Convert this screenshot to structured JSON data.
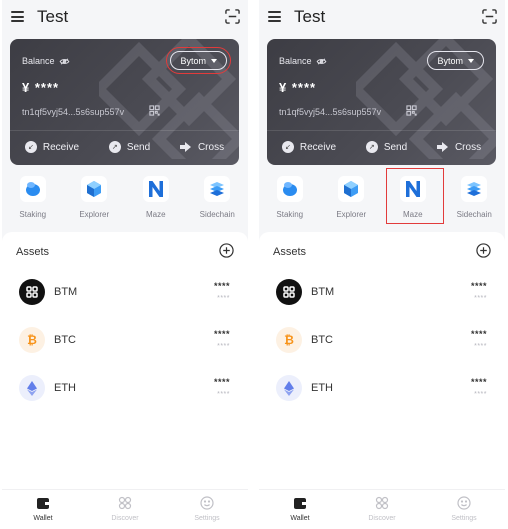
{
  "screens": [
    {
      "app_title": "Test",
      "balance": {
        "label": "Balance",
        "chain": "Bytom",
        "value": "¥ ****",
        "address": "tn1qf5vyj54...5s6sup557v",
        "chain_highlighted": true
      },
      "actions": {
        "receive": "Receive",
        "send": "Send",
        "cross": "Cross"
      },
      "dapps": [
        {
          "label": "Staking",
          "icon": "staking-icon"
        },
        {
          "label": "Explorer",
          "icon": "explorer-cube-icon"
        },
        {
          "label": "Maze",
          "icon": "maze-n-icon"
        },
        {
          "label": "Sidechain",
          "icon": "sidechain-layers-icon"
        }
      ],
      "maze_highlighted": false,
      "assets_title": "Assets",
      "assets": [
        {
          "name": "BTM",
          "amount": "****",
          "value": "****",
          "logo_color": "#111111"
        },
        {
          "name": "BTC",
          "amount": "****",
          "value": "****",
          "logo_color": "#f7931a"
        },
        {
          "name": "ETH",
          "amount": "****",
          "value": "****",
          "logo_color": "#627eea"
        }
      ],
      "tabs": [
        {
          "label": "Wallet",
          "active": true
        },
        {
          "label": "Discover",
          "active": false
        },
        {
          "label": "Settings",
          "active": false
        }
      ]
    },
    {
      "app_title": "Test",
      "balance": {
        "label": "Balance",
        "chain": "Bytom",
        "value": "¥ ****",
        "address": "tn1qf5vyj54...5s6sup557v",
        "chain_highlighted": false
      },
      "actions": {
        "receive": "Receive",
        "send": "Send",
        "cross": "Cross"
      },
      "dapps": [
        {
          "label": "Staking",
          "icon": "staking-icon"
        },
        {
          "label": "Explorer",
          "icon": "explorer-cube-icon"
        },
        {
          "label": "Maze",
          "icon": "maze-n-icon"
        },
        {
          "label": "Sidechain",
          "icon": "sidechain-layers-icon"
        }
      ],
      "maze_highlighted": true,
      "assets_title": "Assets",
      "assets": [
        {
          "name": "BTM",
          "amount": "****",
          "value": "****",
          "logo_color": "#111111"
        },
        {
          "name": "BTC",
          "amount": "****",
          "value": "****",
          "logo_color": "#f7931a"
        },
        {
          "name": "ETH",
          "amount": "****",
          "value": "****",
          "logo_color": "#627eea"
        }
      ],
      "tabs": [
        {
          "label": "Wallet",
          "active": true
        },
        {
          "label": "Discover",
          "active": false
        },
        {
          "label": "Settings",
          "active": false
        }
      ]
    }
  ],
  "colors": {
    "highlight": "#e23b3b",
    "card_bg": "#45454d",
    "accent_blue": "#1e6fd9"
  }
}
